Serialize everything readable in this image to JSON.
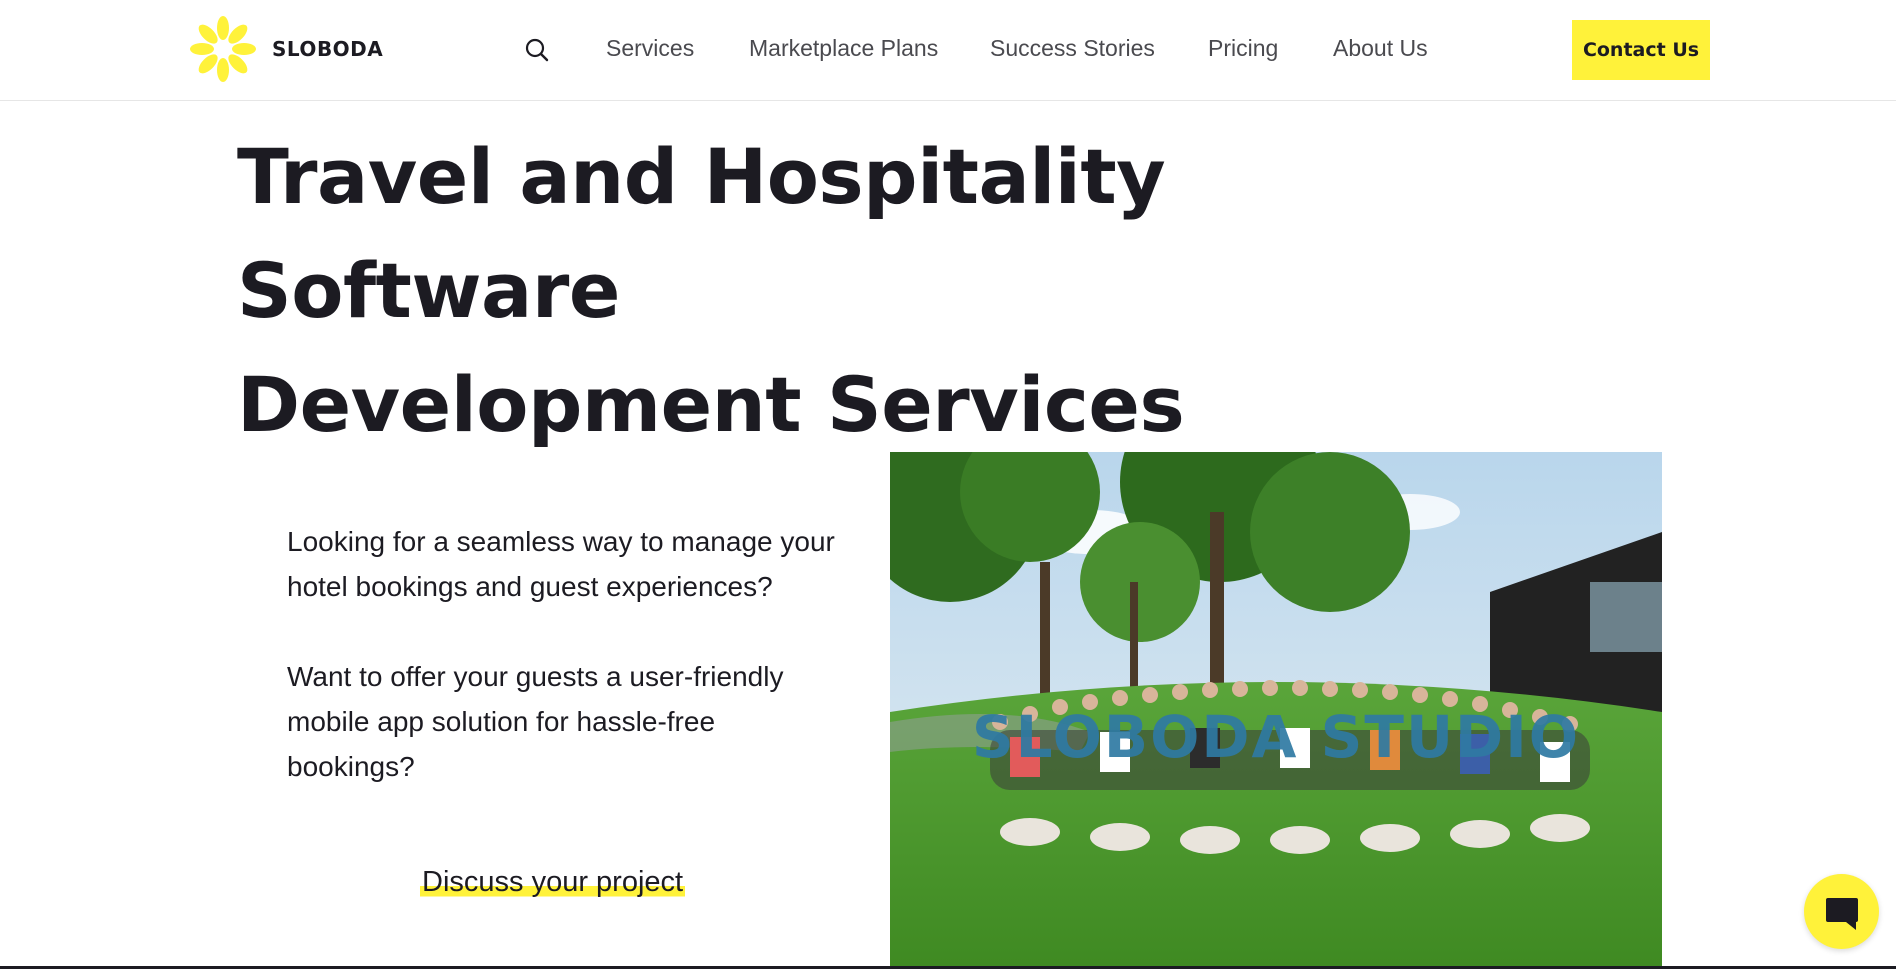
{
  "brand": {
    "name": "SLOBODA",
    "logo_icon": "flower-logo-icon",
    "accent_color": "#fff23a"
  },
  "header": {
    "search_icon": "search-icon",
    "nav": [
      {
        "label": "Services"
      },
      {
        "label": "Marketplace Plans"
      },
      {
        "label": "Success Stories"
      },
      {
        "label": "Pricing"
      },
      {
        "label": "About Us"
      }
    ],
    "contact_label": "Contact Us"
  },
  "main": {
    "title_line1": "Travel and Hospitality Software",
    "title_line2": "Development Services",
    "paragraphs": [
      "Looking for a seamless way to manage your hotel bookings and guest experiences?",
      "Want to offer your guests a user-friendly mobile app solution for hassle-free bookings?"
    ],
    "cta_label": "Discuss your project",
    "photo_text": "SLOBODA STUDIO"
  },
  "chat": {
    "icon": "chat-bubble-icon"
  }
}
